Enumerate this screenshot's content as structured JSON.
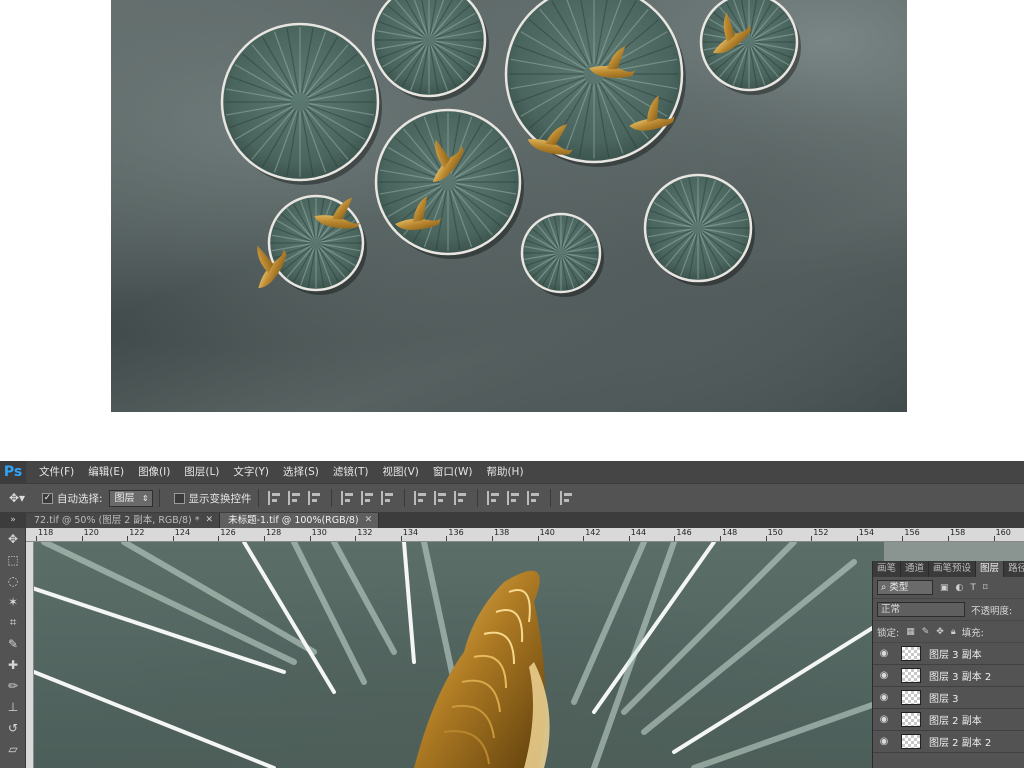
{
  "menubar": {
    "logo": "Ps",
    "items": [
      {
        "label": "文件(F)"
      },
      {
        "label": "编辑(E)"
      },
      {
        "label": "图像(I)"
      },
      {
        "label": "图层(L)"
      },
      {
        "label": "文字(Y)"
      },
      {
        "label": "选择(S)"
      },
      {
        "label": "滤镜(T)"
      },
      {
        "label": "视图(V)"
      },
      {
        "label": "窗口(W)"
      },
      {
        "label": "帮助(H)"
      }
    ]
  },
  "options": {
    "tool_icon": "move-tool-icon",
    "auto_select_label": "自动选择:",
    "auto_select_checked": true,
    "auto_select_target": "图层",
    "show_transform_label": "显示变换控件",
    "show_transform_checked": false
  },
  "tabs": [
    {
      "label": "72.tif @ 50% (图层 2 副本, RGB/8) *",
      "active": false
    },
    {
      "label": "未标题-1.tif @ 100%(RGB/8)",
      "active": true
    }
  ],
  "ruler": {
    "ticks": [
      "118",
      "120",
      "122",
      "124",
      "126",
      "128",
      "130",
      "132",
      "134",
      "136",
      "138",
      "140",
      "142",
      "144",
      "146",
      "148",
      "150",
      "152",
      "154",
      "156",
      "158",
      "160"
    ]
  },
  "layers_panel": {
    "tabs": [
      {
        "label": "画笔",
        "active": false
      },
      {
        "label": "通道",
        "active": false
      },
      {
        "label": "画笔预设",
        "active": false
      },
      {
        "label": "图层",
        "active": true
      },
      {
        "label": "路径",
        "active": false
      }
    ],
    "filter_kind": "类型",
    "blend_mode": "正常",
    "opacity_label": "不透明度:",
    "lock_label": "锁定:",
    "fill_label": "填充:",
    "layers": [
      {
        "name": "图层 3 副本"
      },
      {
        "name": "图层 3 副本 2"
      },
      {
        "name": "图层 3"
      },
      {
        "name": "图层 2 副本"
      },
      {
        "name": "图层 2 副本 2"
      }
    ]
  },
  "colors": {
    "ps_blue": "#2fa3f7",
    "plate_green": "#4f6b63",
    "gold": "#b8862e",
    "wall_gray": "#4d5757"
  }
}
